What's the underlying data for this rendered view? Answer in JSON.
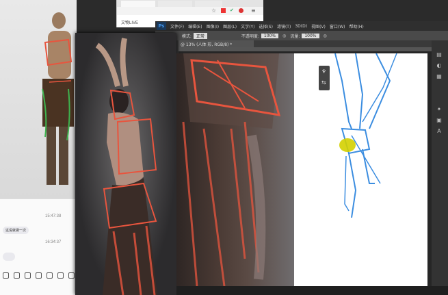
{
  "browser": {
    "tab_label": "",
    "content_text": "文物LIVE"
  },
  "chat": {
    "messages": [
      {
        "time": "15:47:38",
        "text": "这说就做一次"
      },
      {
        "time": "16:34:37",
        "text": ""
      }
    ]
  },
  "photoshop": {
    "logo": "Ps",
    "menus": [
      "文件(F)",
      "编辑(E)",
      "图像(I)",
      "图层(L)",
      "文字(Y)",
      "选择(S)",
      "滤镜(T)",
      "3D(D)",
      "视图(V)",
      "窗口(W)",
      "帮助(H)"
    ],
    "options": {
      "mode_label": "模式:",
      "mode_value": "正常",
      "opacity_label": "不透明度:",
      "opacity_value": "100%",
      "flow_label": "流量:",
      "flow_value": "100%"
    },
    "document_tab": "@ 13% (人体 形, RGB/8) *"
  },
  "colors": {
    "photoshop_bg": "#3a3a3a",
    "sketch_blue": "#3b8de0",
    "overlay_red": "#e8553e",
    "highlight_yellow": "#d4d000"
  }
}
